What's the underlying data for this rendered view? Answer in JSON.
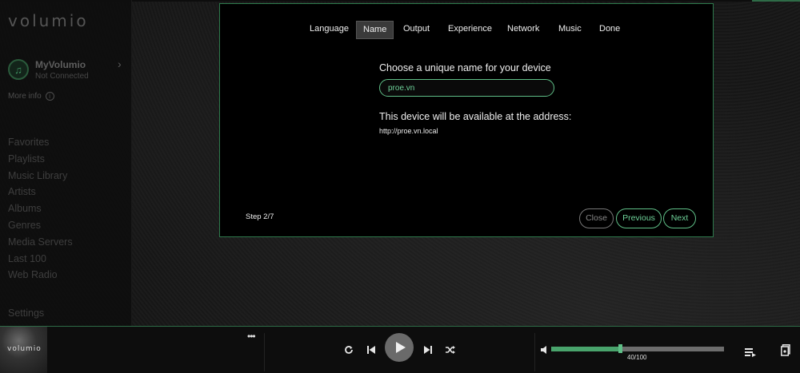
{
  "sidebar": {
    "logo": "volumio",
    "account": {
      "name": "MyVolumio",
      "status": "Not Connected"
    },
    "more_info": "More info",
    "nav_items": [
      "Favorites",
      "Playlists",
      "Music Library",
      "Artists",
      "Albums",
      "Genres",
      "Media Servers",
      "Last 100",
      "Web Radio"
    ],
    "settings": "Settings"
  },
  "wizard": {
    "tabs": [
      "Language",
      "Name",
      "Output",
      "Experience",
      "Network",
      "Music",
      "Done"
    ],
    "active_tab": "Name",
    "prompt": "Choose a unique name for your device",
    "device_name": "proe.vn",
    "availability_text": "This device will be available at the address:",
    "address": "http://proe.vn.local",
    "step_label": "Step 2/7",
    "buttons": {
      "close": "Close",
      "previous": "Previous",
      "next": "Next"
    }
  },
  "player": {
    "album_art_text": "volumio",
    "more_label": "•••",
    "volume_text": "40/100",
    "volume_fraction": 0.4,
    "icons": [
      "repeat-icon",
      "previous-track-icon",
      "play-icon",
      "next-track-icon",
      "shuffle-icon",
      "volume-icon",
      "queue-icon",
      "library-icon"
    ]
  },
  "colors": {
    "accent": "#5fbf87",
    "background": "#000000",
    "text": "#eeeeee"
  }
}
